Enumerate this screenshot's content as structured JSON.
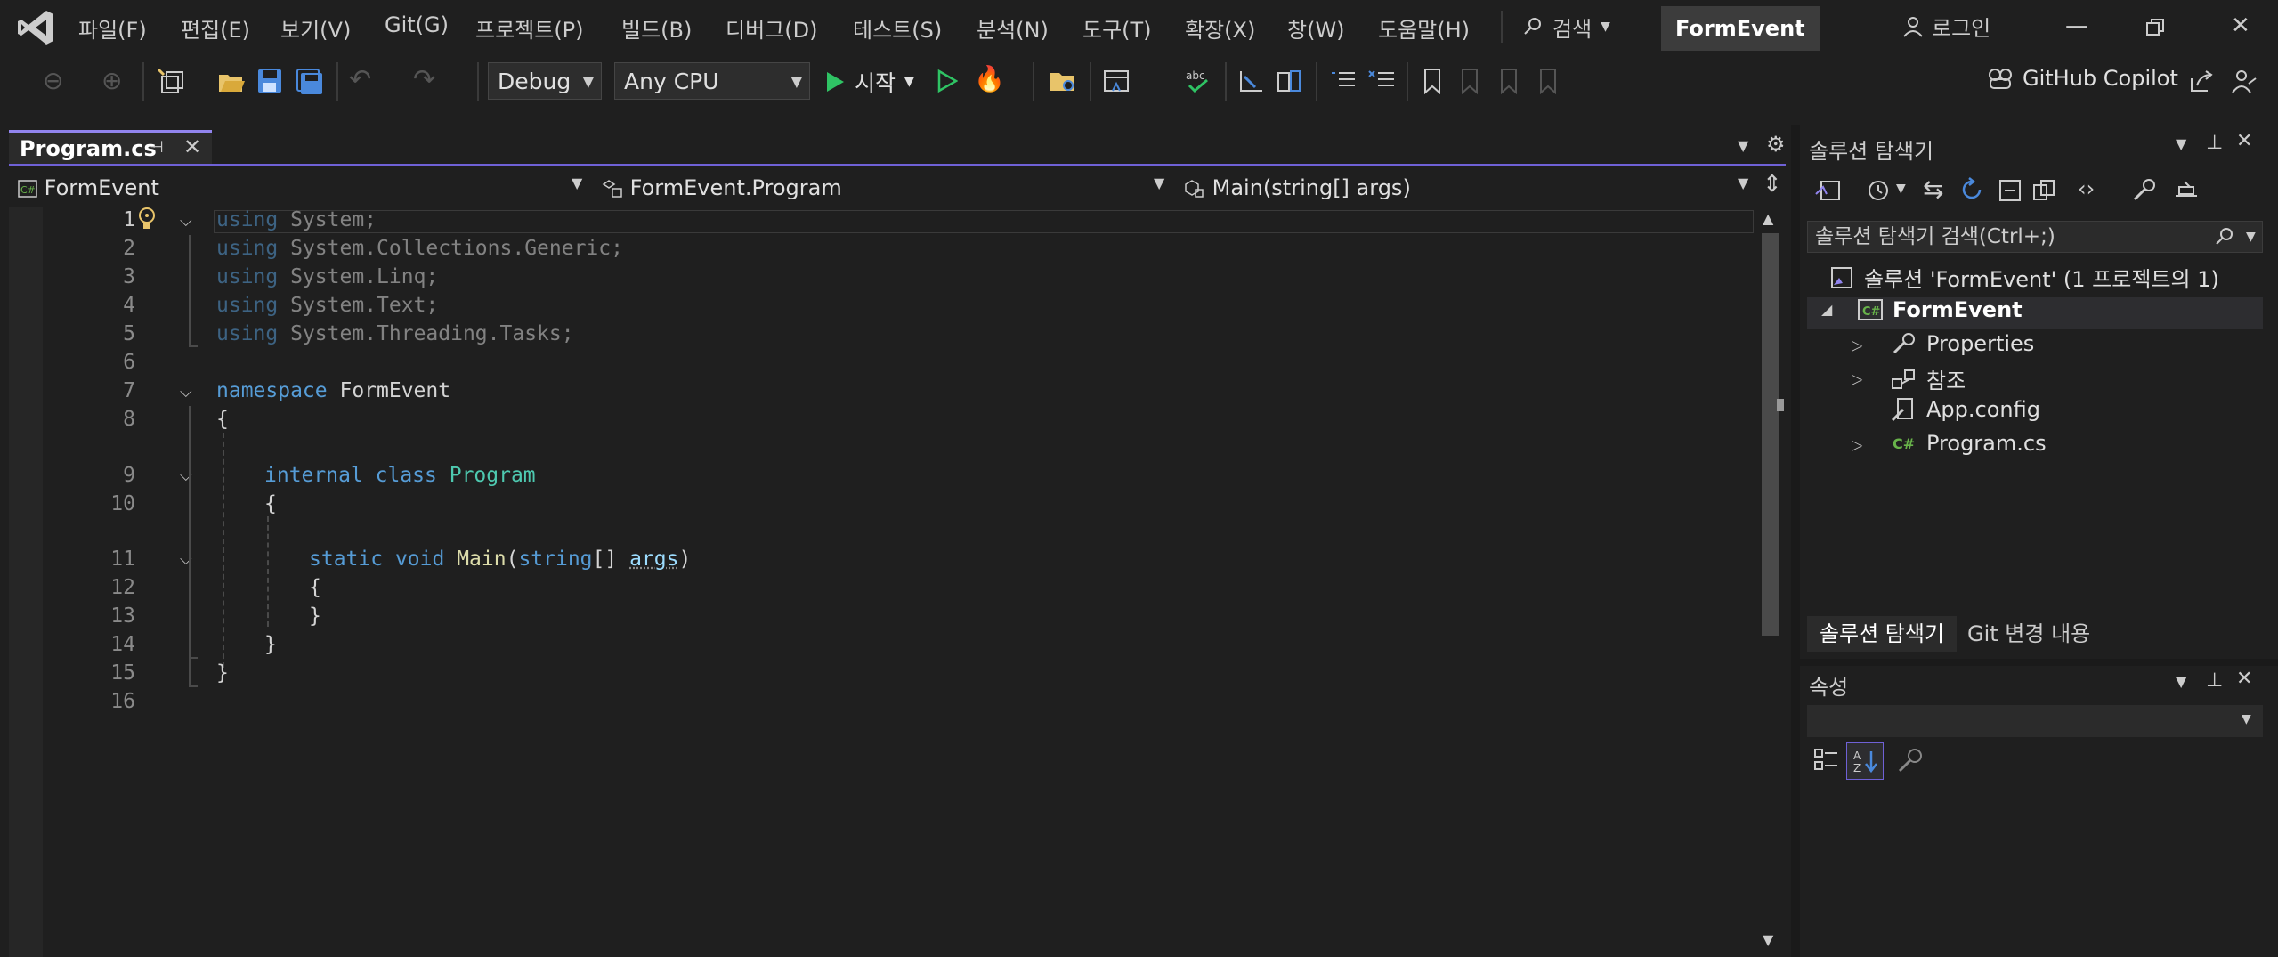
{
  "menu": {
    "items": [
      "파일(F)",
      "편집(E)",
      "보기(V)",
      "Git(G)",
      "프로젝트(P)",
      "빌드(B)",
      "디버그(D)",
      "테스트(S)",
      "분석(N)",
      "도구(T)",
      "확장(X)",
      "창(W)",
      "도움말(H)"
    ],
    "search_label": "검색",
    "solution_name": "FormEvent",
    "login_label": "로그인"
  },
  "toolbar": {
    "config": "Debug",
    "platform": "Any CPU",
    "start_label": "시작",
    "copilot_label": "GitHub Copilot"
  },
  "editor": {
    "tab_label": "Program.cs",
    "nav": {
      "project": "FormEvent",
      "type": "FormEvent.Program",
      "member": "Main(string[] args)"
    },
    "line_numbers": [
      "1",
      "2",
      "3",
      "4",
      "5",
      "6",
      "7",
      "8",
      "9",
      "10",
      "11",
      "12",
      "13",
      "14",
      "15",
      "16"
    ],
    "code": {
      "l1_kw": "using",
      "l1_rest": " System;",
      "l2_kw": "using",
      "l2_rest": " System.Collections.Generic;",
      "l3_kw": "using",
      "l3_rest": " System.Linq;",
      "l4_kw": "using",
      "l4_rest": " System.Text;",
      "l5_kw": "using",
      "l5_rest": " System.Threading.Tasks;",
      "l7_kw": "namespace",
      "l7_rest": " FormEvent",
      "l8": "{",
      "l9_kw1": "internal",
      "l9_kw2": " class ",
      "l9_ty": "Program",
      "l10": "{",
      "l11_kw1": "static",
      "l11_kw2": " void ",
      "l11_fn": "Main",
      "l11_p1": "(",
      "l11_ty": "string",
      "l11_p2": "[] ",
      "l11_pm": "args",
      "l11_p3": ")",
      "l12": "{",
      "l13": "}",
      "l14": "}",
      "l15": "}"
    }
  },
  "solution_explorer": {
    "title": "솔루션 탐색기",
    "search_placeholder": "솔루션 탐색기 검색(Ctrl+;)",
    "solution_node": "솔루션 'FormEvent' (1 프로젝트의 1)",
    "project_node": "FormEvent",
    "items": [
      "Properties",
      "참조",
      "App.config",
      "Program.cs"
    ],
    "tab_active": "솔루션 탐색기",
    "tab_other": "Git 변경 내용"
  },
  "properties": {
    "title": "속성"
  },
  "colors": {
    "accent": "#6f61d6",
    "keyword": "#569cd6",
    "type": "#4ec9b0",
    "function": "#dcdcaa",
    "param": "#9cdcfe",
    "start_green": "#2fc364",
    "csharp_green": "#68b34a"
  }
}
